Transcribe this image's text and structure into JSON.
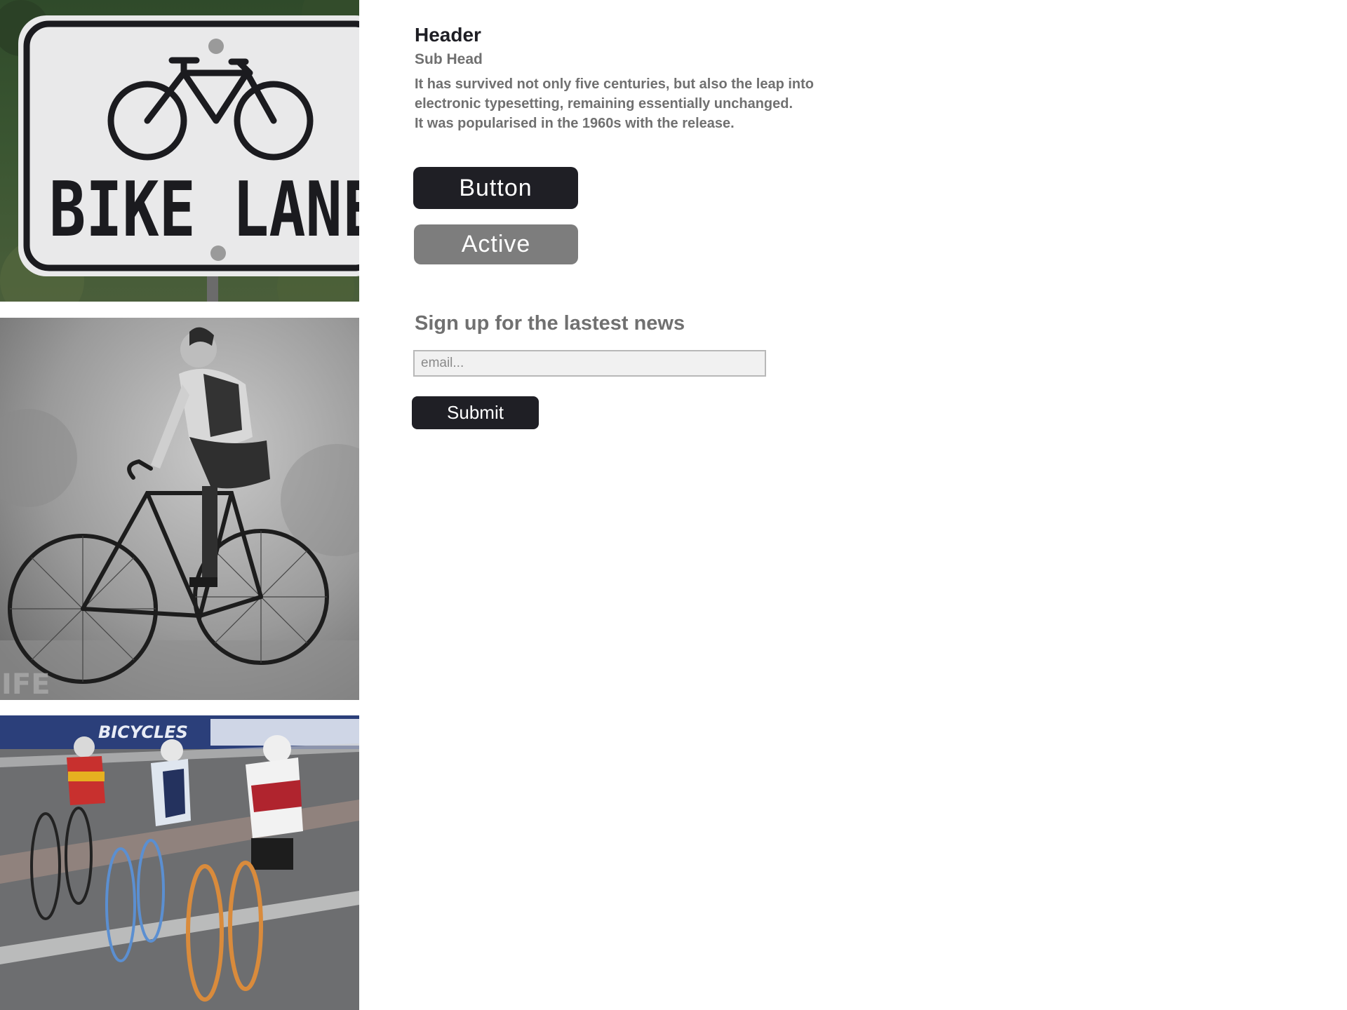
{
  "images": {
    "sign": {
      "alt": "bike-lane-sign-photo",
      "sign_text": "BIKE LANE"
    },
    "rider": {
      "alt": "vintage-cyclist-photo",
      "watermark": "IFE"
    },
    "racers": {
      "alt": "cycling-racers-photo",
      "banner_text": "BICYCLES"
    }
  },
  "content": {
    "header": "Header",
    "subhead": "Sub Head",
    "body_lines": [
      "It has survived not only five centuries, but also the leap into",
      "electronic typesetting, remaining essentially unchanged.",
      "It was popularised in the 1960s with the release."
    ]
  },
  "buttons": {
    "primary_label": "Button",
    "active_label": "Active"
  },
  "signup": {
    "title": "Sign up for the lastest news",
    "email_placeholder": "email...",
    "submit_label": "Submit"
  },
  "colors": {
    "dark_button": "#1f1f25",
    "active_button": "#7d7d7d",
    "text_gray": "#707070",
    "header_text": "#1e1e24"
  }
}
